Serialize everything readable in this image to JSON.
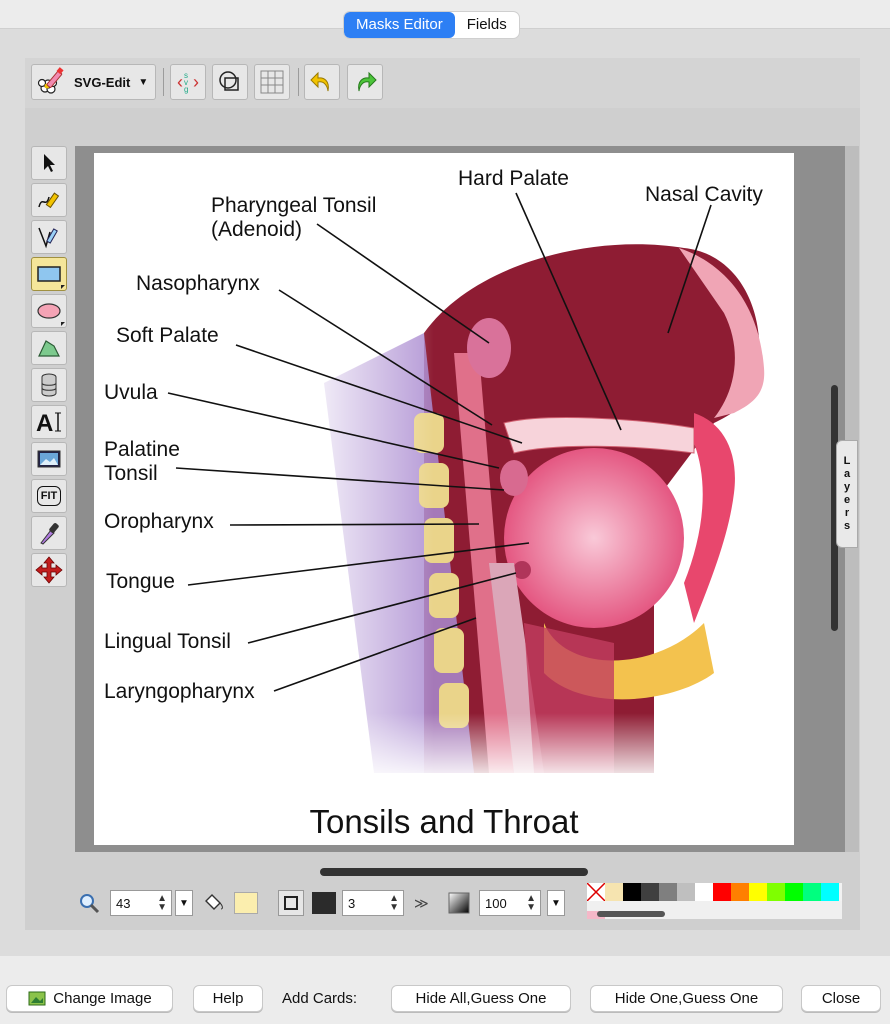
{
  "tabs": {
    "masks_editor": "Masks Editor",
    "fields": "Fields"
  },
  "toolbar": {
    "svg_edit_label": "SVG-Edit",
    "buttons": [
      "svg-source-icon",
      "wireframe-icon",
      "grid-icon",
      "undo-icon",
      "redo-icon"
    ]
  },
  "left_tools": [
    "select-tool",
    "pencil-tool",
    "path-tool",
    "rectangle-tool",
    "ellipse-tool",
    "polygon-tool",
    "database-tool",
    "text-tool",
    "image-tool",
    "fit-tool",
    "eyedropper-tool",
    "move-tool"
  ],
  "fit_label": "FIT",
  "layers_label": "Layers",
  "image": {
    "title": "Tonsils and Throat",
    "labels": {
      "hard_palate": "Hard Palate",
      "nasal_cavity": "Nasal Cavity",
      "pharyngeal_1": "Pharyngeal Tonsil",
      "pharyngeal_2": "(Adenoid)",
      "nasopharynx": "Nasopharynx",
      "soft_palate": "Soft Palate",
      "uvula": "Uvula",
      "palatine_1": "Palatine",
      "palatine_2": "Tonsil",
      "oropharynx": "Oropharynx",
      "tongue": "Tongue",
      "lingual": "Lingual Tonsil",
      "laryngopharynx": "Laryngopharynx"
    }
  },
  "bottom": {
    "zoom": "43",
    "stroke_width": "3",
    "opacity": "100",
    "more": "≫"
  },
  "palette": [
    "#000000",
    "#3f3f3f",
    "#7f7f7f",
    "#bfbfbf",
    "#ffffff",
    "#ff0000",
    "#ff7f00",
    "#ffff00",
    "#7fff00",
    "#00ff00",
    "#00ff7f",
    "#00ffff"
  ],
  "footer": {
    "change_image": "Change Image",
    "help": "Help",
    "add_cards": "Add Cards:",
    "hide_all": "Hide All,Guess One",
    "hide_one": "Hide One,Guess One",
    "close": "Close"
  }
}
